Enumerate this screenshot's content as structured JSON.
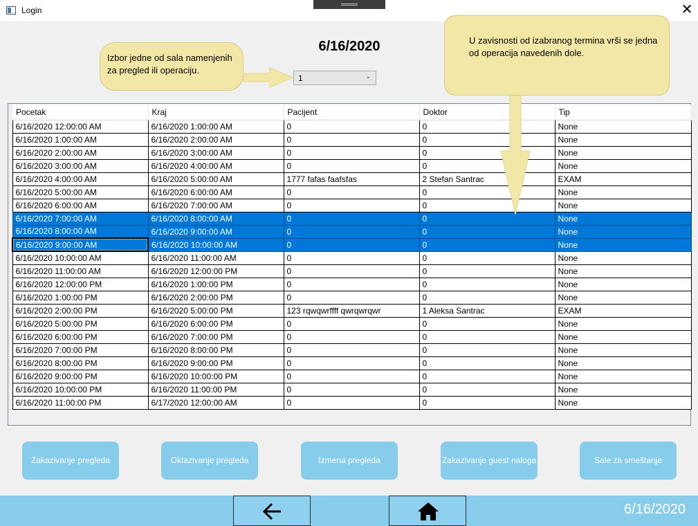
{
  "window": {
    "title": "Login",
    "close_label": "✕"
  },
  "header": {
    "date": "6/16/2020"
  },
  "room_select": {
    "value": "1"
  },
  "callouts": {
    "left": "Izbor jedne od sala namenjenih za pregled ili operaciju.",
    "right": "U zavisnosti od izabranog termina vrši se jedna od operacija navedenih dole."
  },
  "grid": {
    "columns": [
      "Pocetak",
      "Kraj",
      "Pacijent",
      "Doktor",
      "Tip"
    ],
    "rows": [
      [
        "6/16/2020 12:00:00 AM",
        "6/16/2020 1:00:00 AM",
        "0",
        "0",
        "None"
      ],
      [
        "6/16/2020 1:00:00 AM",
        "6/16/2020 2:00:00 AM",
        "0",
        "0",
        "None"
      ],
      [
        "6/16/2020 2:00:00 AM",
        "6/16/2020 3:00:00 AM",
        "0",
        "0",
        "None"
      ],
      [
        "6/16/2020 3:00:00 AM",
        "6/16/2020 4:00:00 AM",
        "0",
        "0",
        "None"
      ],
      [
        "6/16/2020 4:00:00 AM",
        "6/16/2020 5:00:00 AM",
        "1777 fafas faafsfas",
        "2 Stefan Santrac",
        "EXAM"
      ],
      [
        "6/16/2020 5:00:00 AM",
        "6/16/2020 6:00:00 AM",
        "0",
        "0",
        "None"
      ],
      [
        "6/16/2020 6:00:00 AM",
        "6/16/2020 7:00:00 AM",
        "0",
        "0",
        "None"
      ],
      [
        "6/16/2020 7:00:00 AM",
        "6/16/2020 8:00:00 AM",
        "0",
        "0",
        "None"
      ],
      [
        "6/16/2020 8:00:00 AM",
        "6/16/2020 9:00:00 AM",
        "0",
        "0",
        "None"
      ],
      [
        "6/16/2020 9:00:00 AM",
        "6/16/2020 10:00:00 AM",
        "0",
        "0",
        "None"
      ],
      [
        "6/16/2020 10:00:00 AM",
        "6/16/2020 11:00:00 AM",
        "0",
        "0",
        "None"
      ],
      [
        "6/16/2020 11:00:00 AM",
        "6/16/2020 12:00:00 PM",
        "0",
        "0",
        "None"
      ],
      [
        "6/16/2020 12:00:00 PM",
        "6/16/2020 1:00:00 PM",
        "0",
        "0",
        "None"
      ],
      [
        "6/16/2020 1:00:00 PM",
        "6/16/2020 2:00:00 PM",
        "0",
        "0",
        "None"
      ],
      [
        "6/16/2020 2:00:00 PM",
        "6/16/2020 5:00:00 PM",
        "123 rqwqwrffff qwrqwrqwr",
        "1 Aleksa Santrac",
        "EXAM"
      ],
      [
        "6/16/2020 5:00:00 PM",
        "6/16/2020 6:00:00 PM",
        "0",
        "0",
        "None"
      ],
      [
        "6/16/2020 6:00:00 PM",
        "6/16/2020 7:00:00 PM",
        "0",
        "0",
        "None"
      ],
      [
        "6/16/2020 7:00:00 PM",
        "6/16/2020 8:00:00 PM",
        "0",
        "0",
        "None"
      ],
      [
        "6/16/2020 8:00:00 PM",
        "6/16/2020 9:00:00 PM",
        "0",
        "0",
        "None"
      ],
      [
        "6/16/2020 9:00:00 PM",
        "6/16/2020 10:00:00 PM",
        "0",
        "0",
        "None"
      ],
      [
        "6/16/2020 10:00:00 PM",
        "6/16/2020 11:00:00 PM",
        "0",
        "0",
        "None"
      ],
      [
        "6/16/2020 11:00:00 PM",
        "6/17/2020 12:00:00 AM",
        "0",
        "0",
        "None"
      ]
    ],
    "selected_rows": [
      7,
      8,
      9
    ],
    "focused_row": 9
  },
  "actions": {
    "schedule": "Zakazivanje pregleda",
    "cancel": "Oktazivanje pregleda",
    "edit": "Izmena pregleda",
    "guest": "Zakazivanje guest naloga",
    "rooms": "Sale za smeštanje"
  },
  "footer": {
    "date": "6/16/2020",
    "back_icon": "arrow-left-icon",
    "home_icon": "home-icon"
  },
  "colors": {
    "accent": "#87CDEB",
    "selection": "#0078D7",
    "callout": "#F3E7A8"
  }
}
